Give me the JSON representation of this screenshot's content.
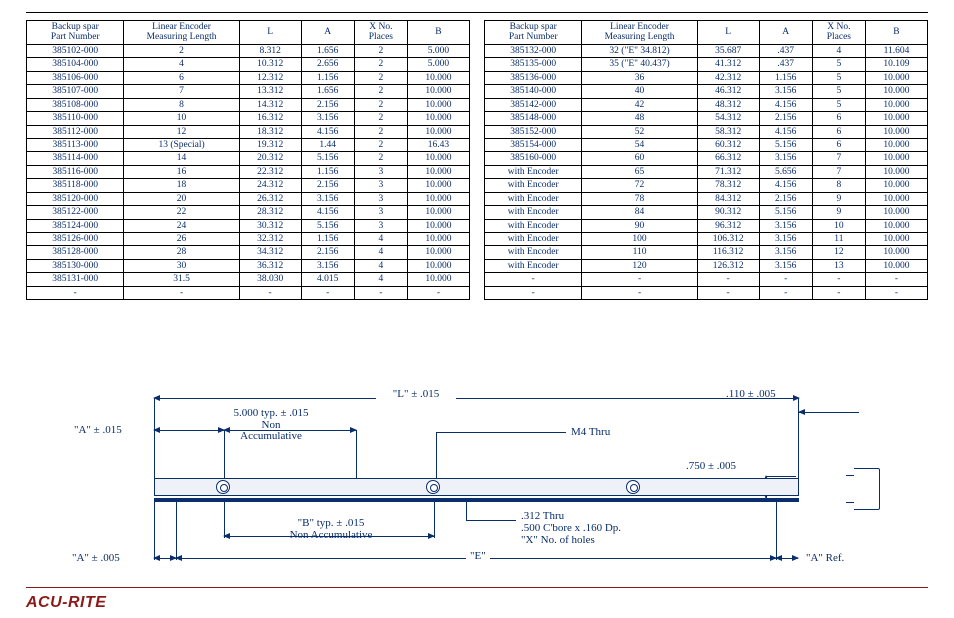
{
  "brand": "ACU-RITE",
  "headers": [
    "Backup spar\nPart Number",
    "Linear Encoder\nMeasuring Length",
    "L",
    "A",
    "X No.\nPlaces",
    "B"
  ],
  "left": [
    [
      "385102-000",
      "2",
      "8.312",
      "1.656",
      "2",
      "5.000"
    ],
    [
      "385104-000",
      "4",
      "10.312",
      "2.656",
      "2",
      "5.000"
    ],
    [
      "385106-000",
      "6",
      "12.312",
      "1.156",
      "2",
      "10.000"
    ],
    [
      "385107-000",
      "7",
      "13.312",
      "1.656",
      "2",
      "10.000"
    ],
    [
      "385108-000",
      "8",
      "14.312",
      "2.156",
      "2",
      "10.000"
    ],
    [
      "385110-000",
      "10",
      "16.312",
      "3.156",
      "2",
      "10.000"
    ],
    [
      "385112-000",
      "12",
      "18.312",
      "4.156",
      "2",
      "10.000"
    ],
    [
      "385113-000",
      "13 (Special)",
      "19.312",
      "1.44",
      "2",
      "16.43"
    ],
    [
      "385114-000",
      "14",
      "20.312",
      "5.156",
      "2",
      "10.000"
    ],
    [
      "385116-000",
      "16",
      "22.312",
      "1.156",
      "3",
      "10.000"
    ],
    [
      "385118-000",
      "18",
      "24.312",
      "2.156",
      "3",
      "10.000"
    ],
    [
      "385120-000",
      "20",
      "26.312",
      "3.156",
      "3",
      "10.000"
    ],
    [
      "385122-000",
      "22",
      "28.312",
      "4.156",
      "3",
      "10.000"
    ],
    [
      "385124-000",
      "24",
      "30.312",
      "5.156",
      "3",
      "10.000"
    ],
    [
      "385126-000",
      "26",
      "32.312",
      "1.156",
      "4",
      "10.000"
    ],
    [
      "385128-000",
      "28",
      "34.312",
      "2.156",
      "4",
      "10.000"
    ],
    [
      "385130-000",
      "30",
      "36.312",
      "3.156",
      "4",
      "10.000"
    ],
    [
      "385131-000",
      "31.5",
      "38.030",
      "4.015",
      "4",
      "10.000"
    ],
    [
      "-",
      "-",
      "-",
      "-",
      "-",
      "-"
    ]
  ],
  "right": [
    [
      "385132-000",
      "32 (\"E\" 34.812)",
      "35.687",
      ".437",
      "4",
      "11.604"
    ],
    [
      "385135-000",
      "35 (\"E\" 40.437)",
      "41.312",
      ".437",
      "5",
      "10.109"
    ],
    [
      "385136-000",
      "36",
      "42.312",
      "1.156",
      "5",
      "10.000"
    ],
    [
      "385140-000",
      "40",
      "46.312",
      "3.156",
      "5",
      "10.000"
    ],
    [
      "385142-000",
      "42",
      "48.312",
      "4.156",
      "5",
      "10.000"
    ],
    [
      "385148-000",
      "48",
      "54.312",
      "2.156",
      "6",
      "10.000"
    ],
    [
      "385152-000",
      "52",
      "58.312",
      "4.156",
      "6",
      "10.000"
    ],
    [
      "385154-000",
      "54",
      "60.312",
      "5.156",
      "6",
      "10.000"
    ],
    [
      "385160-000",
      "60",
      "66.312",
      "3.156",
      "7",
      "10.000"
    ],
    [
      "with Encoder",
      "65",
      "71.312",
      "5.656",
      "7",
      "10.000"
    ],
    [
      "with Encoder",
      "72",
      "78.312",
      "4.156",
      "8",
      "10.000"
    ],
    [
      "with Encoder",
      "78",
      "84.312",
      "2.156",
      "9",
      "10.000"
    ],
    [
      "with Encoder",
      "84",
      "90.312",
      "5.156",
      "9",
      "10.000"
    ],
    [
      "with Encoder",
      "90",
      "96.312",
      "3.156",
      "10",
      "10.000"
    ],
    [
      "with Encoder",
      "100",
      "106.312",
      "3.156",
      "11",
      "10.000"
    ],
    [
      "with Encoder",
      "110",
      "116.312",
      "3.156",
      "12",
      "10.000"
    ],
    [
      "with Encoder",
      "120",
      "126.312",
      "3.156",
      "13",
      "10.000"
    ],
    [
      "-",
      "-",
      "-",
      "-",
      "-",
      "-"
    ],
    [
      "-",
      "-",
      "-",
      "-",
      "-",
      "-"
    ]
  ],
  "diagram": {
    "L": "\"L\" ± .015",
    "A015": "\"A\" ± .015",
    "A005": "\"A\" ± .005",
    "ARef": "\"A\" Ref.",
    "E": "\"E\"",
    "fiveTyp": "5.000 typ. ± .015\nNon\nAccumulative",
    "bTyp": "\"B\" typ. ± .015\nNon Accumulative",
    "m4": "M4 Thru",
    "cbore": ".312 Thru\n.500 C'bore x .160 Dp.\n\"X\" No. of holes",
    "h110": ".110 ± .005",
    "h750": ".750 ± .005"
  }
}
